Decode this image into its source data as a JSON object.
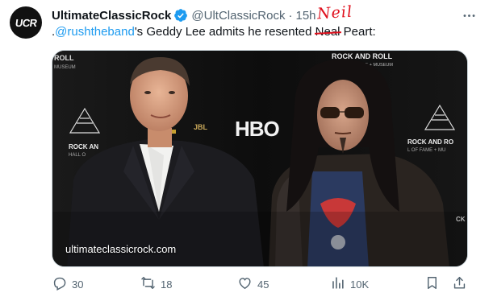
{
  "tweet": {
    "avatar_text": "UCR",
    "display_name": "UltimateClassicRock",
    "handle": "@UltClassicRock",
    "separator": "·",
    "time": "15h",
    "text_prefix": ".",
    "mention": "@rushtheband",
    "text_middle": "'s Geddy Lee admits he resented ",
    "struck_word": "Neal",
    "handwritten_correction": "Neil",
    "text_suffix": " Peart:",
    "media": {
      "watermark": "ultimateclassicrock.com",
      "backdrop_top_left": "ROLL\nMUSEUM",
      "backdrop_top_right_1": "ROCK AND ROLL",
      "backdrop_top_right_2": "HALL OF FAME + MUSEUM",
      "backdrop_left_1": "ROCK AN",
      "backdrop_left_2": "HALL O",
      "backdrop_right_1": "ROCK AND RO",
      "backdrop_right_2": "L OF FAME + MU",
      "backdrop_hbo": "HBO",
      "backdrop_jbl": "JBL",
      "backdrop_edge": "CK"
    },
    "actions": {
      "replies": "30",
      "retweets": "18",
      "likes": "45",
      "views": "10K"
    },
    "colors": {
      "link": "#1d9bf0",
      "muted": "#536471",
      "verified": "#1d9bf0",
      "annotation": "#e0101d"
    }
  }
}
